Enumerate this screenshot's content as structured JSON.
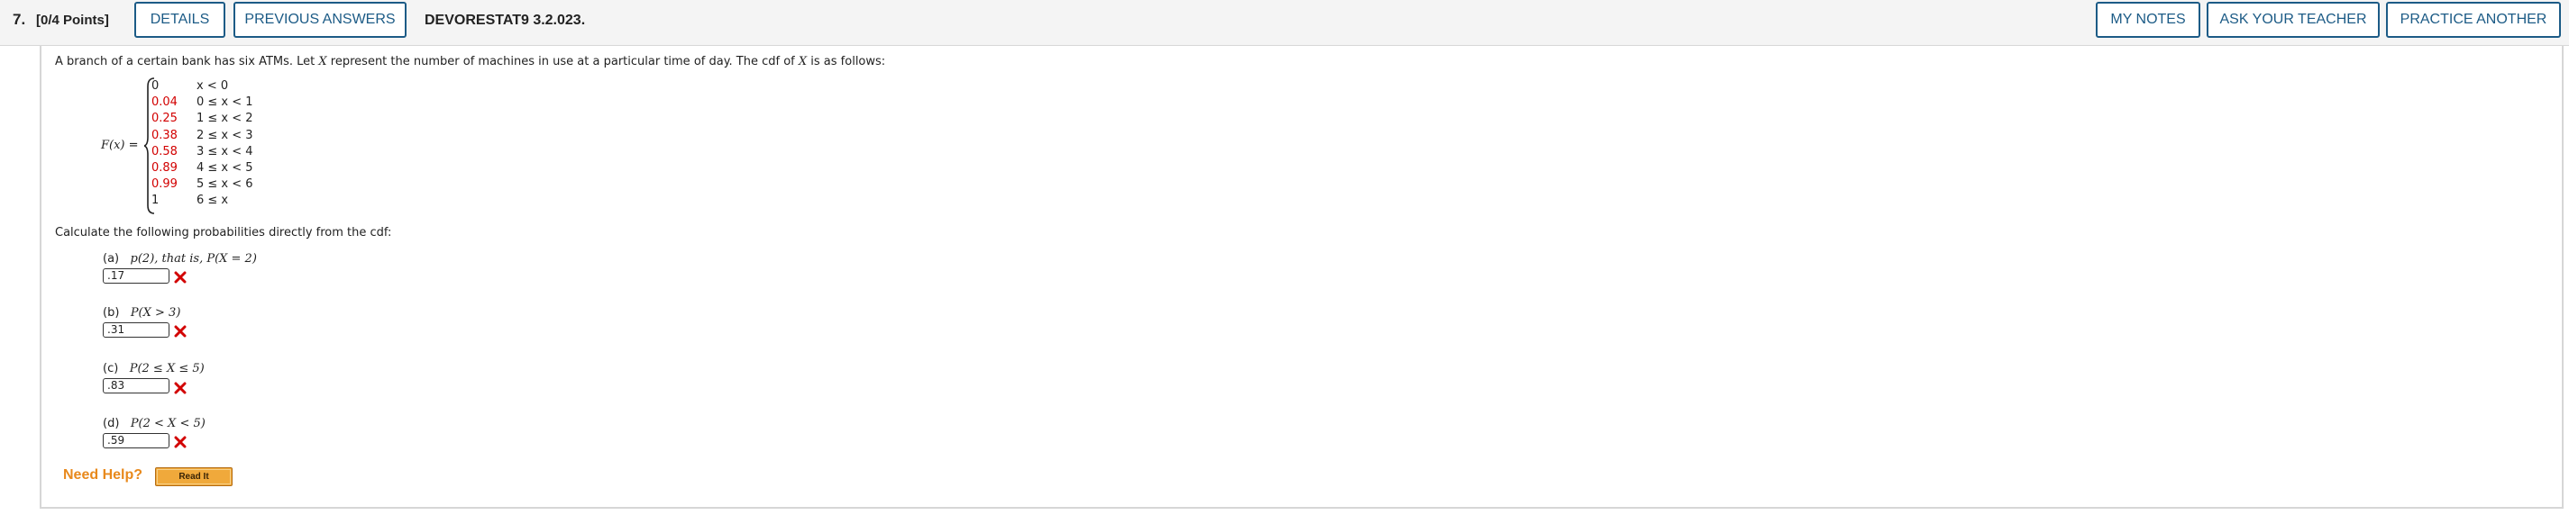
{
  "header": {
    "question_number": "7.",
    "points": "[0/4 Points]",
    "details_label": "DETAILS",
    "previous_answers_label": "PREVIOUS ANSWERS",
    "source": "DEVORESTAT9 3.2.023.",
    "my_notes_label": "MY NOTES",
    "ask_teacher_label": "ASK YOUR TEACHER",
    "practice_another_label": "PRACTICE ANOTHER"
  },
  "question": {
    "intro_part1": "A branch of a certain bank has six ATMs. Let ",
    "intro_var1": "X",
    "intro_part2": " represent the number of machines in use at a particular time of day. The cdf of ",
    "intro_var2": "X",
    "intro_part3": " is as follows:",
    "fx_label": "F(x)",
    "fx_eq": " =",
    "cdf_rows": [
      {
        "value": "0",
        "condition": "x < 0",
        "highlight": false
      },
      {
        "value": "0.04",
        "condition": "0 ≤ x < 1",
        "highlight": true
      },
      {
        "value": "0.25",
        "condition": "1 ≤ x < 2",
        "highlight": true
      },
      {
        "value": "0.38",
        "condition": "2 ≤ x < 3",
        "highlight": true
      },
      {
        "value": "0.58",
        "condition": "3 ≤ x < 4",
        "highlight": true
      },
      {
        "value": "0.89",
        "condition": "4 ≤ x < 5",
        "highlight": true
      },
      {
        "value": "0.99",
        "condition": "5 ≤ x < 6",
        "highlight": true
      },
      {
        "value": "1",
        "condition": "6 ≤ x",
        "highlight": false
      }
    ],
    "calc_instruction": "Calculate the following probabilities directly from the cdf:",
    "parts": [
      {
        "label": "(a)",
        "expr": "p(2), that is, P(X = 2)",
        "answer": ".17",
        "status": "incorrect"
      },
      {
        "label": "(b)",
        "expr": "P(X > 3)",
        "answer": ".31",
        "status": "incorrect"
      },
      {
        "label": "(c)",
        "expr": "P(2 ≤ X ≤ 5)",
        "answer": ".83",
        "status": "incorrect"
      },
      {
        "label": "(d)",
        "expr": "P(2 < X < 5)",
        "answer": ".59",
        "status": "incorrect"
      }
    ]
  },
  "help": {
    "need_help_label": "Need Help?",
    "read_it_label": "Read It"
  },
  "colors": {
    "accent_blue": "#1c5b86",
    "incorrect_red": "#d20000",
    "help_orange": "#e8891c",
    "readit_fill": "#f0a93b"
  }
}
